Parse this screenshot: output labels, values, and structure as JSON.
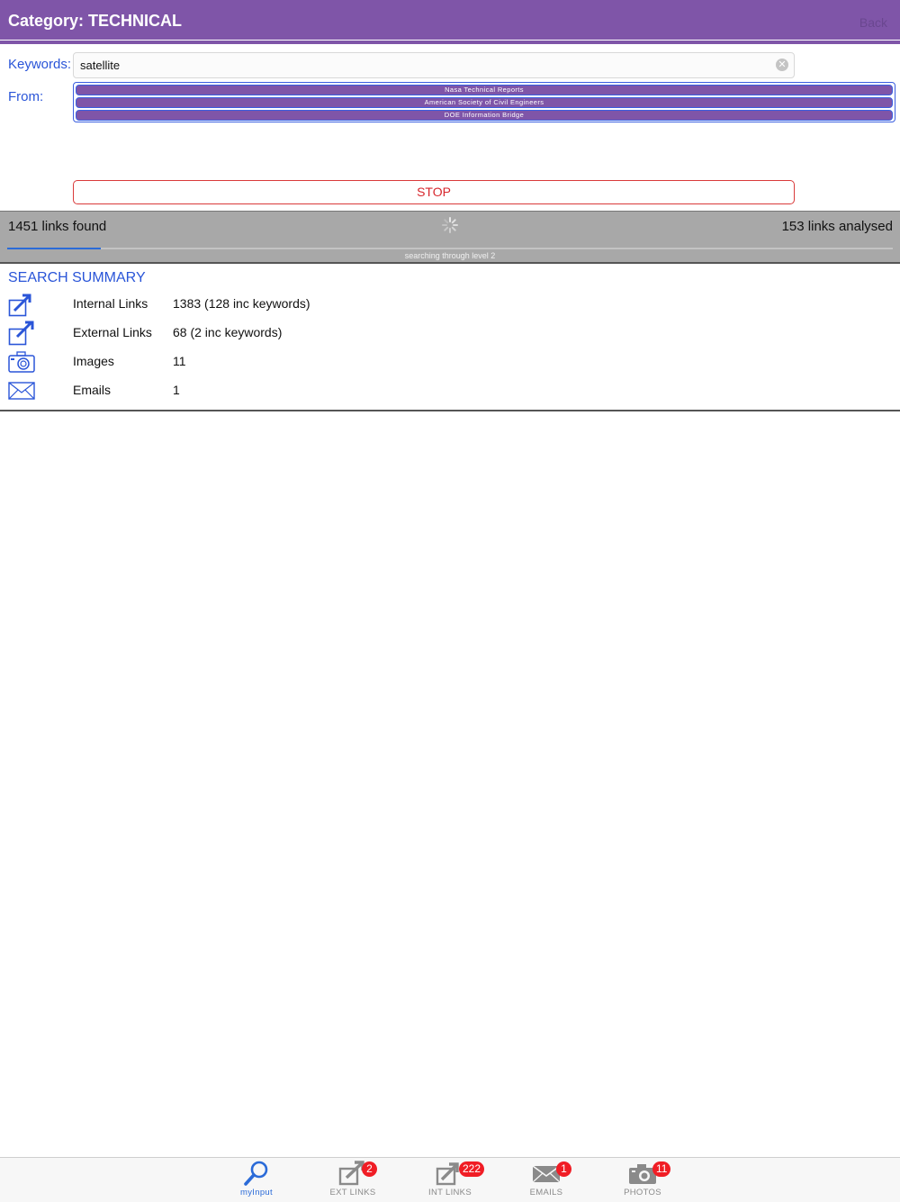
{
  "header": {
    "title": "Category: TECHNICAL",
    "right_label": "Back"
  },
  "form": {
    "keywords_label": "Keywords:",
    "keywords_value": "satellite",
    "from_label": "From:",
    "sources": [
      "Nasa Technical Reports",
      "American Society of Civil Engineers",
      "DOE Information Bridge"
    ],
    "stop_label": "STOP"
  },
  "status": {
    "found": "1451 links found",
    "analysed": "153 links analysed",
    "level": "searching through level 2",
    "progress_fraction": 0.106
  },
  "summary": {
    "title": "SEARCH SUMMARY",
    "rows": [
      {
        "icon": "internal-link-icon",
        "label": "Internal Links",
        "value": "1383 (128 inc keywords)"
      },
      {
        "icon": "external-link-icon",
        "label": "External Links",
        "value": "68 (2 inc keywords)"
      },
      {
        "icon": "camera-icon",
        "label": "Images",
        "value": "11"
      },
      {
        "icon": "envelope-icon",
        "label": "Emails",
        "value": "1"
      }
    ]
  },
  "tabs": [
    {
      "label": "myInput",
      "icon": "search-icon",
      "badge": null,
      "active": true
    },
    {
      "label": "EXT LINKS",
      "icon": "external-link-icon",
      "badge": "2",
      "active": false
    },
    {
      "label": "INT LINKS",
      "icon": "internal-link-icon",
      "badge": "222",
      "active": false
    },
    {
      "label": "EMAILS",
      "icon": "envelope-icon",
      "badge": "1",
      "active": false
    },
    {
      "label": "PHOTOS",
      "icon": "camera-icon",
      "badge": "11",
      "active": false
    }
  ],
  "colors": {
    "header": "#7f55a8",
    "accent": "#2a55d8",
    "stop": "#d7262c",
    "badge": "#f01d25",
    "status_bg": "#a8a8a8"
  }
}
